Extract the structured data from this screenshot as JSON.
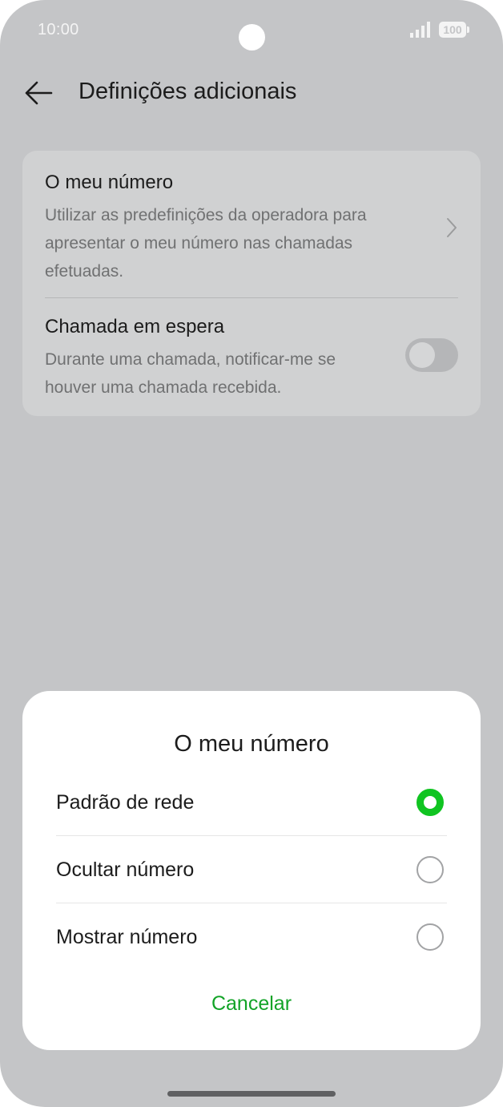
{
  "status_bar": {
    "time": "10:00",
    "battery": "100"
  },
  "header": {
    "back_icon": "arrow-left-icon",
    "title": "Definições adicionais"
  },
  "settings": {
    "items": [
      {
        "title": "O meu número",
        "description": "Utilizar as predefinições da operadora para apresentar o meu número nas chamadas efetuadas.",
        "control": "chevron-right-icon"
      },
      {
        "title": "Chamada em espera",
        "description": "Durante uma chamada, notificar-me se houver uma chamada recebida.",
        "control": "toggle",
        "enabled": false
      }
    ]
  },
  "dialog": {
    "title": "O meu número",
    "options": [
      {
        "label": "Padrão de rede",
        "selected": true
      },
      {
        "label": "Ocultar número",
        "selected": false
      },
      {
        "label": "Mostrar número",
        "selected": false
      }
    ],
    "cancel_label": "Cancelar"
  },
  "colors": {
    "accent": "#10c421",
    "cancel_text": "#12a327",
    "scrim": "#c4c5c7"
  }
}
